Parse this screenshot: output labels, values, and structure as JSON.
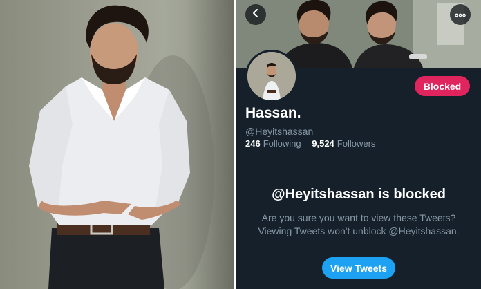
{
  "profile": {
    "name": "Hassan.",
    "handle": "@Heyitshassan",
    "following_count": "246",
    "following_label": "Following",
    "followers_count": "9,524",
    "followers_label": "Followers",
    "blocked_label": "Blocked"
  },
  "blocked_notice": {
    "title": "@Heyitshassan is blocked",
    "message": "Are you sure you want to view these Tweets? Viewing Tweets won't unblock @Heyitshassan.",
    "button_label": "View Tweets"
  },
  "icons": {
    "back": "chevron-left-icon",
    "more": "more-horizontal-icon"
  },
  "colors": {
    "background": "#15202b",
    "blocked": "#e0245e",
    "accent": "#1da1f2",
    "secondary_text": "#8899a6"
  }
}
